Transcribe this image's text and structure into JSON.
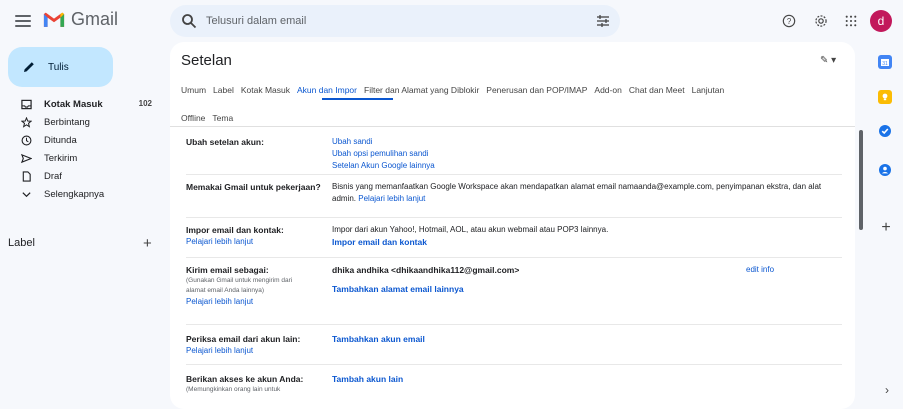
{
  "app": {
    "name": "Gmail"
  },
  "search": {
    "placeholder": "Telusuri dalam email"
  },
  "avatar": {
    "initial": "d"
  },
  "compose": {
    "label": "Tulis"
  },
  "nav": {
    "items": [
      {
        "label": "Kotak Masuk",
        "count": "102",
        "icon": "inbox-icon"
      },
      {
        "label": "Berbintang",
        "icon": "star-icon"
      },
      {
        "label": "Ditunda",
        "icon": "clock-icon"
      },
      {
        "label": "Terkirim",
        "icon": "send-icon"
      },
      {
        "label": "Draf",
        "icon": "draft-icon"
      },
      {
        "label": "Selengkapnya",
        "icon": "chevron-down-icon"
      }
    ],
    "labels_heading": "Label"
  },
  "settings": {
    "title": "Setelan",
    "tabs": [
      "Umum",
      "Label",
      "Kotak Masuk",
      "Akun dan Impor",
      "Filter dan Alamat yang Diblokir",
      "Penerusan dan POP/IMAP",
      "Add-on",
      "Chat dan Meet",
      "Lanjutan"
    ],
    "tabs_row2": [
      "Offline",
      "Tema"
    ],
    "active_tab": "Akun dan Impor",
    "rows": {
      "change_account": {
        "label": "Ubah setelan akun:",
        "links": [
          "Ubah sandi",
          "Ubah opsi pemulihan sandi",
          "Setelan Akun Google lainnya"
        ]
      },
      "work": {
        "label": "Memakai Gmail untuk pekerjaan?",
        "text": "Bisnis yang memanfaatkan Google Workspace akan mendapatkan alamat email namaanda@example.com, penyimpanan ekstra, dan alat admin.",
        "link": "Pelajari lebih lanjut"
      },
      "import": {
        "label": "Impor email dan kontak:",
        "learn": "Pelajari lebih lanjut",
        "text": "Impor dari akun Yahoo!, Hotmail, AOL, atau akun webmail atau POP3 lainnya.",
        "action": "Impor email dan kontak"
      },
      "send_as": {
        "label": "Kirim email sebagai:",
        "note": "(Gunakan Gmail untuk mengirim dari alamat email Anda lainnya)",
        "learn": "Pelajari lebih lanjut",
        "identity": "dhika andhika <dhikaandhika112@gmail.com>",
        "edit": "edit info",
        "action": "Tambahkan alamat email lainnya"
      },
      "check_mail": {
        "label": "Periksa email dari akun lain:",
        "learn": "Pelajari lebih lanjut",
        "action": "Tambahkan akun email"
      },
      "grant_access": {
        "label": "Berikan akses ke akun Anda:",
        "note": "(Memungkinkan orang lain untuk",
        "action": "Tambah akun lain"
      }
    }
  },
  "colors": {
    "accent": "#0b57d0",
    "compose_bg": "#c2e7ff",
    "search_bg": "#eaf1fb",
    "avatar_bg": "#c2185b"
  }
}
